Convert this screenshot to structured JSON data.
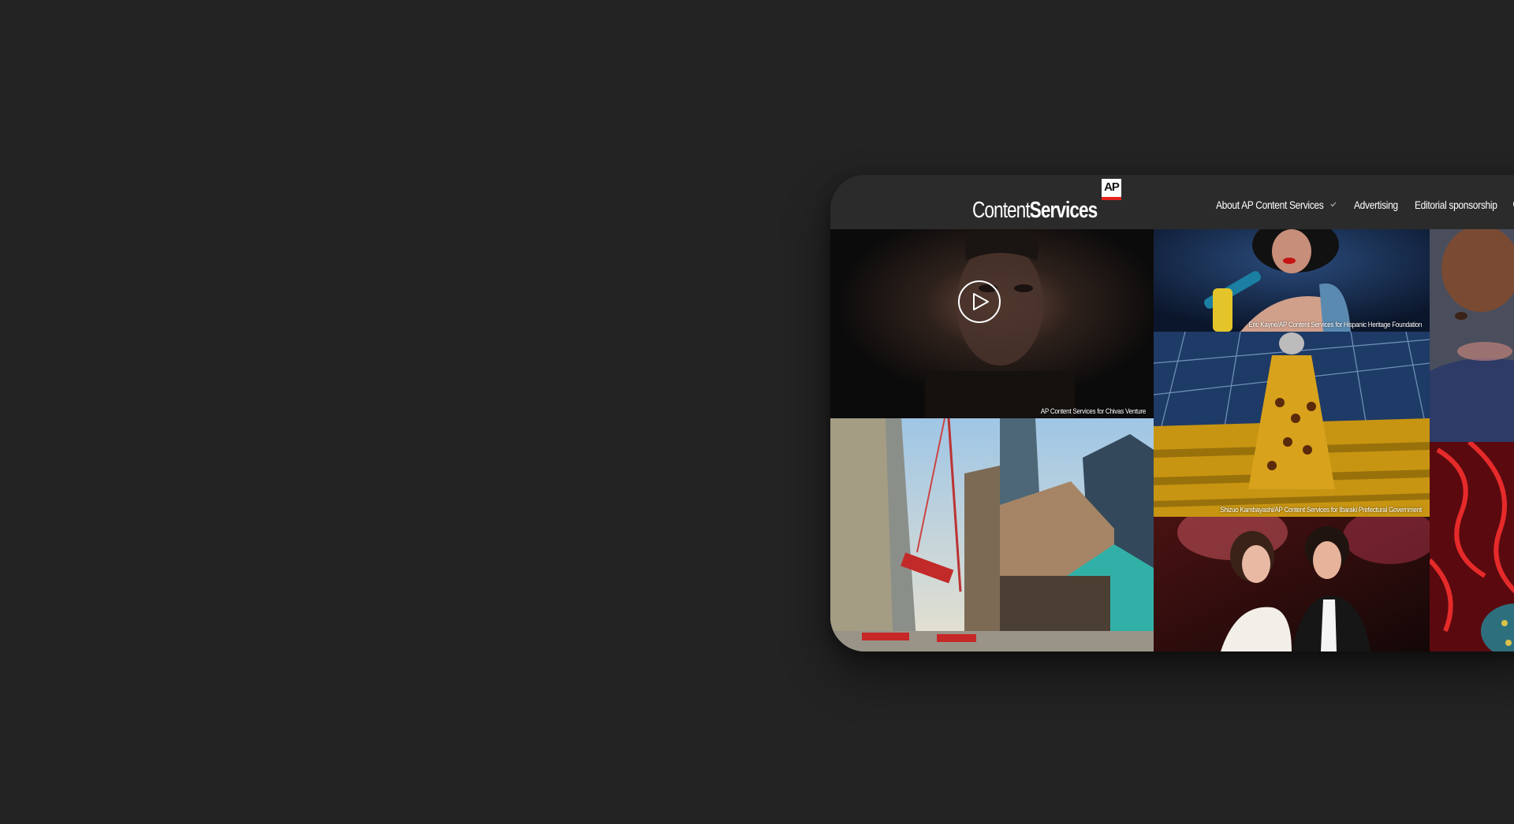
{
  "header": {
    "logo": {
      "text_light": "Content",
      "text_bold": "Services",
      "badge": "AP"
    },
    "nav": [
      {
        "label": "About AP Content Services",
        "has_dropdown": true
      },
      {
        "label": "Advertising",
        "has_dropdown": false
      },
      {
        "label": "Editorial sponsorship",
        "has_dropdown": false
      }
    ]
  },
  "gallery": {
    "tiles": [
      {
        "caption": "AP Content Services for Chivas Venture",
        "video": true
      },
      {
        "caption": ""
      },
      {
        "caption": "Eric Kayne/AP Content Services for Hispanic Heritage Foundation"
      },
      {
        "caption": "Shizuo Kambayashi/AP Content Services for Ibaraki Prefectural Government"
      },
      {
        "caption": ""
      },
      {
        "caption": ""
      },
      {
        "caption": ""
      }
    ]
  },
  "colors": {
    "background": "#232323",
    "header": "#2b2b2b",
    "ap_red": "#e2231a"
  }
}
